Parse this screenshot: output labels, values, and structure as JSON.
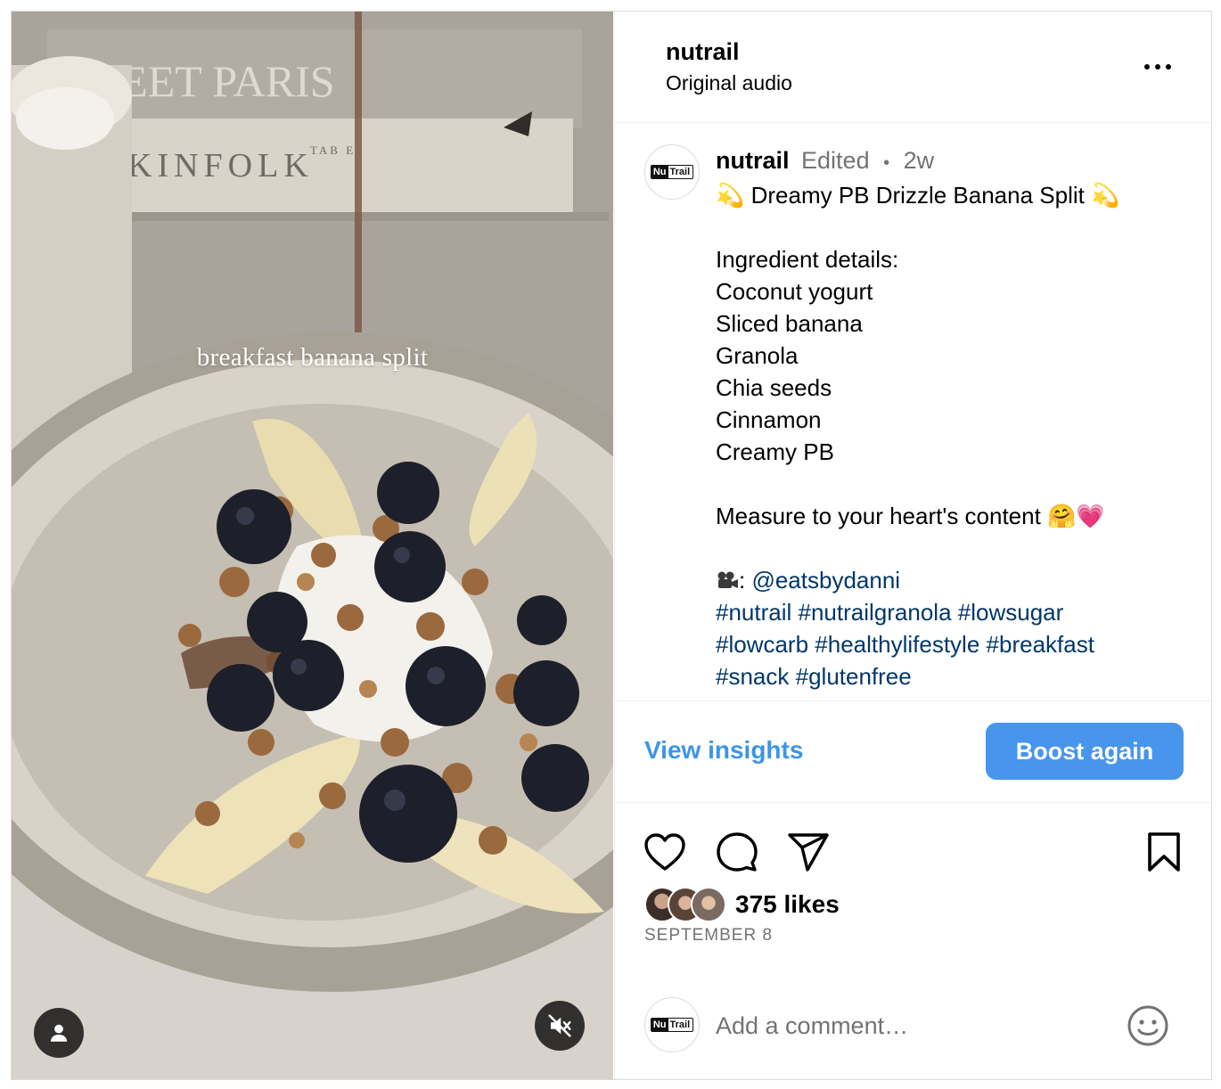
{
  "media": {
    "overlay_text": "breakfast banana split",
    "book_text_1": "WEET PARIS",
    "book_text_2": "KINFOLK",
    "book_text_3": "TAB E"
  },
  "header": {
    "username": "nutrail",
    "audio": "Original audio"
  },
  "caption": {
    "username": "nutrail",
    "edited": "Edited",
    "dot": "•",
    "time": "2w",
    "lines": [
      "💫 Dreamy PB Drizzle Banana Split 💫",
      "",
      "Ingredient details:",
      "Coconut yogurt",
      "Sliced banana",
      "Granola",
      "Chia seeds",
      "Cinnamon",
      "Creamy PB",
      "",
      "Measure to your heart's content 🤗💗",
      ""
    ],
    "credit_prefix": ": ",
    "mention": "@eatsbydanni",
    "hashtags": [
      [
        "#nutrail",
        "#nutrailgranola",
        "#lowsugar"
      ],
      [
        "#lowcarb",
        "#healthylifestyle",
        "#breakfast"
      ],
      [
        "#snack",
        "#glutenfree"
      ]
    ]
  },
  "logo": {
    "part1": "Nu",
    "part2": "Trail"
  },
  "actions": {
    "view_insights": "View insights",
    "boost_again": "Boost again"
  },
  "engagement": {
    "likes": "375 likes",
    "date": "SEPTEMBER 8"
  },
  "comment": {
    "placeholder": "Add a comment…"
  },
  "icons": {
    "more": "more-options-icon",
    "like": "heart-icon",
    "comment": "comment-bubble-icon",
    "share": "paper-plane-icon",
    "save": "bookmark-icon",
    "user": "user-tag-icon",
    "mute": "muted-speaker-icon",
    "emoji": "smiley-icon"
  },
  "colors": {
    "link": "#00376b",
    "insights": "#3b95e8",
    "boost": "#4795ec",
    "muted_text": "#737373"
  }
}
